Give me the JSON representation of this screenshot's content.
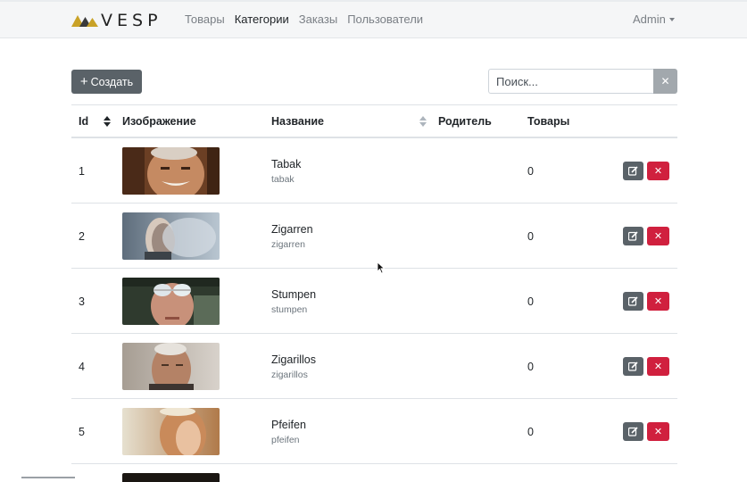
{
  "brand": {
    "name": "VESP"
  },
  "nav": {
    "items": [
      "Товары",
      "Категории",
      "Заказы",
      "Пользователи"
    ],
    "active_index": 1,
    "user": "Admin"
  },
  "toolbar": {
    "create_label": "Создать",
    "search_placeholder": "Поиск...",
    "clear_icon": "close-icon"
  },
  "table": {
    "columns": [
      "Id",
      "Изображение",
      "Название",
      "Родитель",
      "Товары"
    ],
    "rows": [
      {
        "id": "1",
        "name": "Tabak",
        "slug": "tabak",
        "parent": "",
        "products": "0"
      },
      {
        "id": "2",
        "name": "Zigarren",
        "slug": "zigarren",
        "parent": "",
        "products": "0"
      },
      {
        "id": "3",
        "name": "Stumpen",
        "slug": "stumpen",
        "parent": "",
        "products": "0"
      },
      {
        "id": "4",
        "name": "Zigarillos",
        "slug": "zigarillos",
        "parent": "",
        "products": "0"
      },
      {
        "id": "5",
        "name": "Pfeifen",
        "slug": "pfeifen",
        "parent": "",
        "products": "0"
      }
    ]
  },
  "colors": {
    "navbar_bg": "#f5f6f7",
    "button_secondary": "#5a6268",
    "button_danger": "#d0203e",
    "brand_gold": "#c9a227"
  }
}
